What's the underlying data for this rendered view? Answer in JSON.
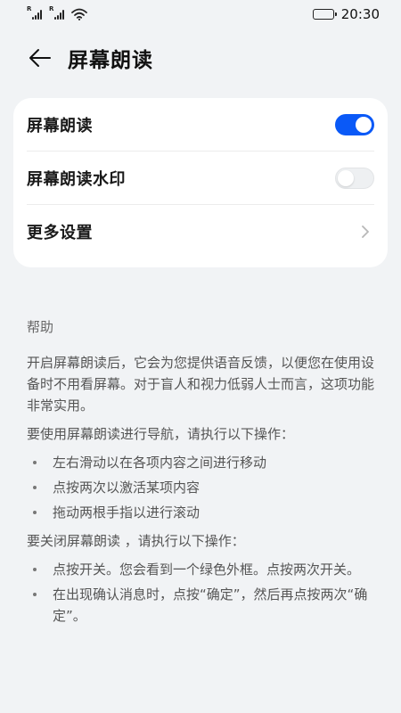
{
  "status_bar": {
    "sim1_tag": "R",
    "sim2_tag": "R",
    "time": "20:30"
  },
  "header": {
    "title": "屏幕朗读"
  },
  "settings": {
    "items": [
      {
        "label": "屏幕朗读",
        "type": "toggle",
        "state": "on"
      },
      {
        "label": "屏幕朗读水印",
        "type": "toggle",
        "state": "off"
      },
      {
        "label": "更多设置",
        "type": "link"
      }
    ]
  },
  "help": {
    "title": "帮助",
    "intro": "开启屏幕朗读后，它会为您提供语音反馈，以便您在使用设备时不用看屏幕。对于盲人和视力低弱人士而言，这项功能非常实用。",
    "nav_heading": "要使用屏幕朗读进行导航，请执行以下操作：",
    "nav_steps": [
      "左右滑动以在各项内容之间进行移动",
      "点按两次以激活某项内容",
      "拖动两根手指以进行滚动"
    ],
    "off_heading": "要关闭屏幕朗读 ，请执行以下操作：",
    "off_steps": [
      "点按开关。您会看到一个绿色外框。点按两次开关。",
      "在出现确认消息时，点按“确定”，然后再点按两次“确定”。"
    ]
  },
  "colors": {
    "accent": "#0a59f7",
    "background": "#f1f3f5",
    "card": "#ffffff"
  },
  "icons": {
    "back": "arrow-left-icon",
    "chevron": "chevron-right-icon",
    "wifi": "wifi-icon",
    "battery": "battery-icon",
    "signal": "signal-icon"
  }
}
